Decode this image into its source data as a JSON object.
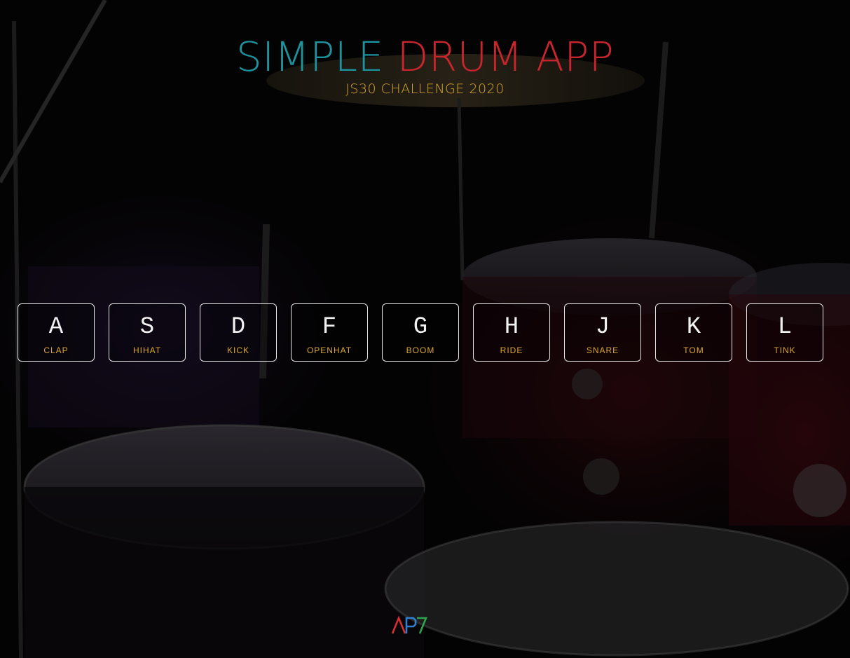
{
  "header": {
    "title_part1": "SIMPLE",
    "title_part2": "DRUM APP",
    "subtitle": "JS30 CHALLENGE 2020"
  },
  "keys": [
    {
      "key": "A",
      "sound": "CLAP"
    },
    {
      "key": "S",
      "sound": "HIHAT"
    },
    {
      "key": "D",
      "sound": "KICK"
    },
    {
      "key": "F",
      "sound": "OPENHAT"
    },
    {
      "key": "G",
      "sound": "BOOM"
    },
    {
      "key": "H",
      "sound": "RIDE"
    },
    {
      "key": "J",
      "sound": "SNARE"
    },
    {
      "key": "K",
      "sound": "TOM"
    },
    {
      "key": "L",
      "sound": "TINK"
    }
  ],
  "footer": {
    "logo_text": "AP7"
  },
  "colors": {
    "title_primary": "#1c939d",
    "title_accent": "#c8252d",
    "subtitle": "#d9a72f",
    "key_border": "#e6e6e6",
    "sound_label": "#d9a72f"
  },
  "icons": {
    "background": "drum-kit-photo",
    "footer": "ap7-logo"
  }
}
